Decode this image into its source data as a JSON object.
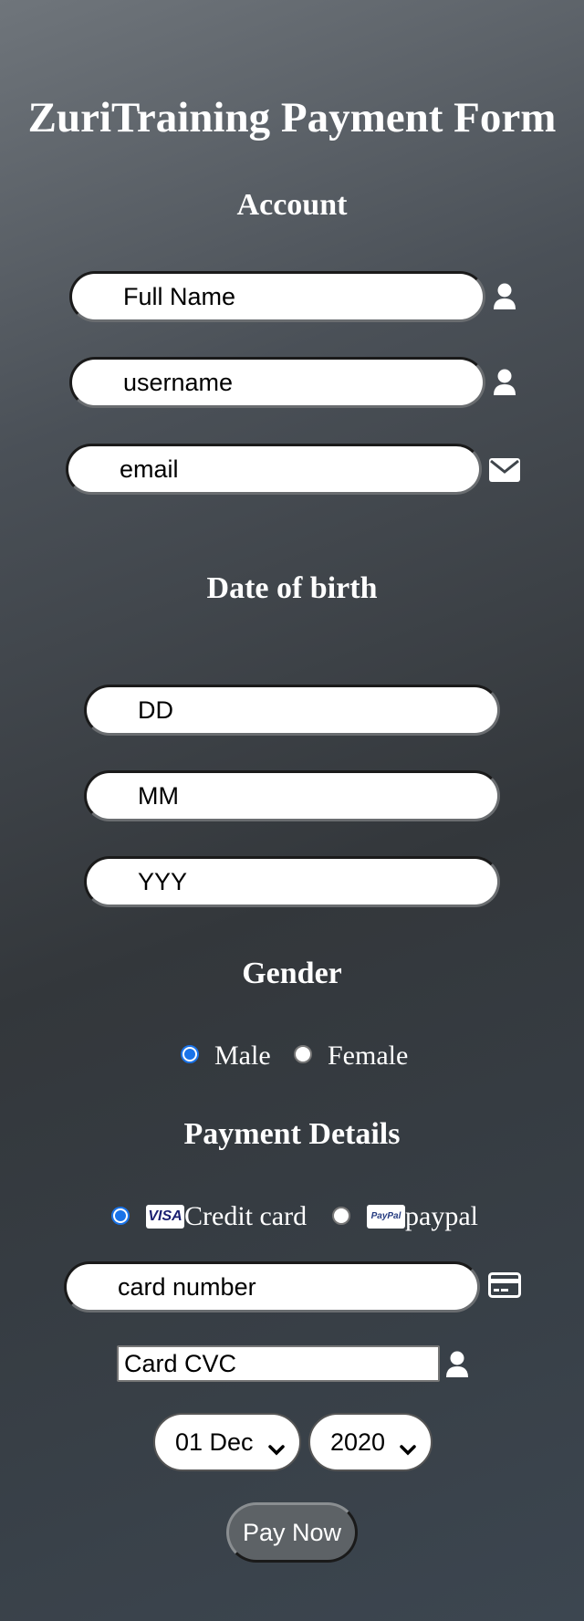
{
  "title": "ZuriTraining Payment Form",
  "account": {
    "heading": "Account",
    "full_name_placeholder": "Full Name",
    "username_placeholder": "username",
    "email_placeholder": "email"
  },
  "dob": {
    "heading": "Date of birth",
    "day_placeholder": "DD",
    "month_placeholder": "MM",
    "year_placeholder": "YYY"
  },
  "gender": {
    "heading": "Gender",
    "options": [
      {
        "label": "Male",
        "selected": true
      },
      {
        "label": "Female",
        "selected": false
      }
    ]
  },
  "payment": {
    "heading": "Payment Details",
    "methods": [
      {
        "label": "Credit card",
        "badge": "VISA",
        "selected": true
      },
      {
        "label": "paypal",
        "badge": "PayPal",
        "selected": false
      }
    ],
    "card_number_placeholder": "card number",
    "cvc_placeholder": "Card CVC",
    "expiry_day_month": "01 Dec",
    "expiry_year": "2020",
    "submit_label": "Pay Now"
  },
  "colors": {
    "accent": "#1a73e8",
    "button": "#5d6266"
  },
  "icons": [
    "user-icon",
    "envelope-icon",
    "credit-card-icon",
    "chevron-down-icon",
    "visa-icon",
    "paypal-icon"
  ]
}
